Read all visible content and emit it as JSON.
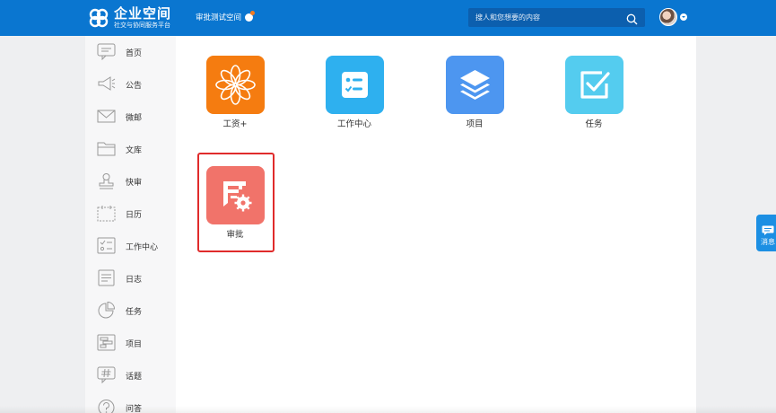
{
  "header": {
    "brand_name": "企业空间",
    "brand_tagline": "社交与协同服务平台",
    "space_name": "审批测试空间",
    "search_placeholder": "搜人和您想要的内容",
    "colors": {
      "bar": "#0a76d0",
      "search_bg": "#0c5fae",
      "badge": "#f47b20"
    }
  },
  "sidebar": {
    "items": [
      {
        "label": "首页",
        "icon": "comment-icon"
      },
      {
        "label": "公告",
        "icon": "megaphone-icon"
      },
      {
        "label": "微邮",
        "icon": "mail-icon"
      },
      {
        "label": "文库",
        "icon": "folder-icon"
      },
      {
        "label": "快审",
        "icon": "stamp-icon"
      },
      {
        "label": "日历",
        "icon": "calendar-icon"
      },
      {
        "label": "工作中心",
        "icon": "checklist-icon"
      },
      {
        "label": "日志",
        "icon": "log-icon"
      },
      {
        "label": "任务",
        "icon": "pie-icon"
      },
      {
        "label": "项目",
        "icon": "project-icon"
      },
      {
        "label": "话题",
        "icon": "hashtag-icon"
      },
      {
        "label": "问答",
        "icon": "question-icon"
      }
    ]
  },
  "apps": [
    {
      "label": "工资+",
      "color": "#f57c10",
      "icon": "flower-icon"
    },
    {
      "label": "工作中心",
      "color": "#2eb0ef",
      "icon": "checklist-icon"
    },
    {
      "label": "项目",
      "color": "#4d96f0",
      "icon": "layers-icon"
    },
    {
      "label": "任务",
      "color": "#54ccef",
      "icon": "check-square-icon"
    },
    {
      "label": "审批",
      "color": "#f1736a",
      "icon": "approval-icon",
      "highlighted": true
    }
  ],
  "side_tab": {
    "label": "消息",
    "color": "#1c8fe3"
  },
  "highlight_color": "#e02b2b"
}
